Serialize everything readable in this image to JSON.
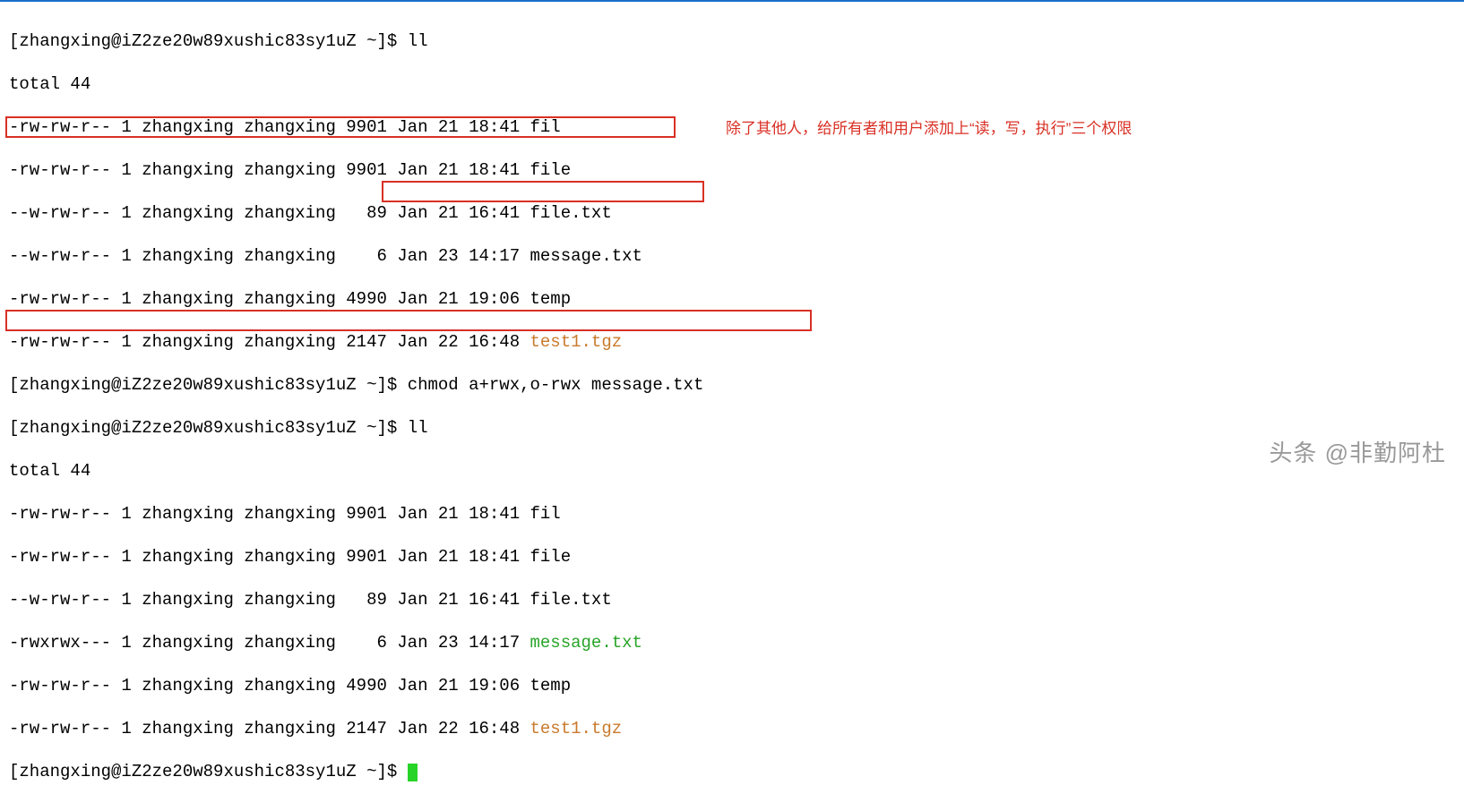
{
  "prompt": "[zhangxing@iZ2ze20w89xushic83sy1uZ ~]$ ",
  "cmd_ll": "ll",
  "cmd_chmod": "chmod a+rwx,o-rwx message.txt",
  "total": "total 44",
  "ls1": {
    "fil": "-rw-rw-r-- 1 zhangxing zhangxing 9901 Jan 21 18:41 ",
    "file": "-rw-rw-r-- 1 zhangxing zhangxing 9901 Jan 21 18:41 ",
    "filetxt": "--w-rw-r-- 1 zhangxing zhangxing   89 Jan 21 16:41 ",
    "msg": "--w-rw-r-- 1 zhangxing zhangxing    6 Jan 23 14:17 ",
    "temp": "-rw-rw-r-- 1 zhangxing zhangxing 4990 Jan 21 19:06 ",
    "tgz": "-rw-rw-r-- 1 zhangxing zhangxing 2147 Jan 22 16:48 "
  },
  "ls2": {
    "fil": "-rw-rw-r-- 1 zhangxing zhangxing 9901 Jan 21 18:41 ",
    "file": "-rw-rw-r-- 1 zhangxing zhangxing 9901 Jan 21 18:41 ",
    "filetxt": "--w-rw-r-- 1 zhangxing zhangxing   89 Jan 21 16:41 ",
    "msg": "-rwxrwx--- 1 zhangxing zhangxing    6 Jan 23 14:17 ",
    "temp": "-rw-rw-r-- 1 zhangxing zhangxing 4990 Jan 21 19:06 ",
    "tgz": "-rw-rw-r-- 1 zhangxing zhangxing 2147 Jan 22 16:48 "
  },
  "names": {
    "fil": "fil",
    "file": "file",
    "filetxt": "file.txt",
    "msg": "message.txt",
    "temp": "temp",
    "tgz": "test1.tgz"
  },
  "annotation": "除了其他人，给所有者和用户添加上“读，写，执行”三个权限",
  "watermark": "头条 @非勤阿杜"
}
